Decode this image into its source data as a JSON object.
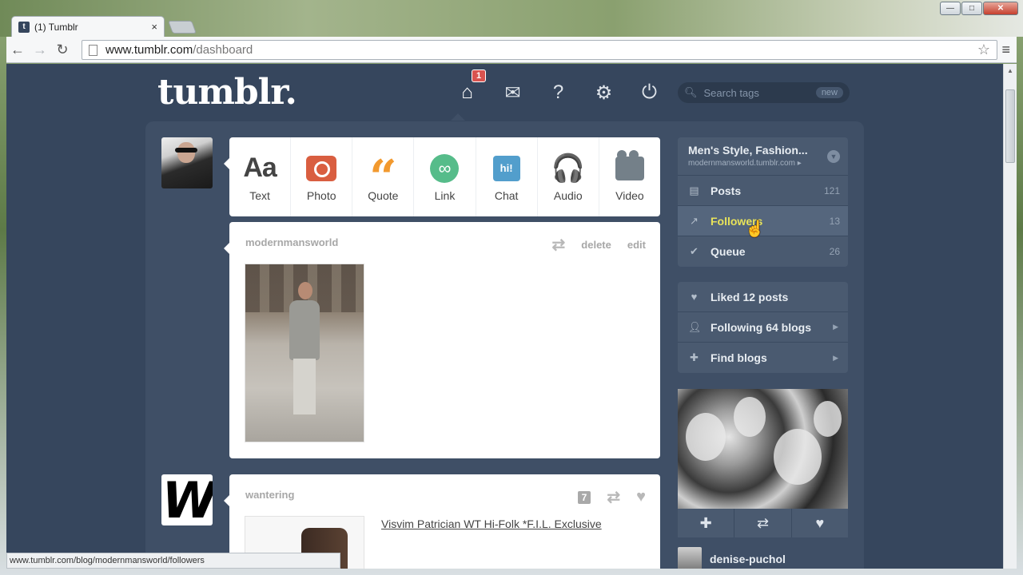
{
  "browser": {
    "tab_title": "(1) Tumblr",
    "tab_close": "×",
    "tab_favicon": "t",
    "url_host": "www.tumblr.com",
    "url_path": "/dashboard",
    "status_url": "www.tumblr.com/blog/modernmansworld/followers",
    "window_controls": {
      "minimize": "—",
      "maximize": "□",
      "close": "✕"
    }
  },
  "header": {
    "logo": "tumblr.",
    "notifications_count": "1",
    "search_placeholder": "Search tags",
    "search_badge": "new"
  },
  "post_types": [
    {
      "label": "Text",
      "glyph": "Aa",
      "color": "#444444"
    },
    {
      "label": "Photo",
      "glyph": "",
      "color": "#d95e40"
    },
    {
      "label": "Quote",
      "glyph": "“",
      "color": "#f2992e"
    },
    {
      "label": "Link",
      "glyph": "∞",
      "color": "#56bc8a"
    },
    {
      "label": "Chat",
      "glyph": "hi!",
      "color": "#529ecc"
    },
    {
      "label": "Audio",
      "glyph": "🎧",
      "color": "#a77dc2"
    },
    {
      "label": "Video",
      "glyph": "",
      "color": "#748089"
    }
  ],
  "posts": [
    {
      "author": "modernmansworld",
      "actions": {
        "delete": "delete",
        "edit": "edit"
      }
    },
    {
      "author": "wantering",
      "notes": "7",
      "link_title": "Visvim Patrician WT Hi-Folk *F.I.L. Exclusive"
    }
  ],
  "sidebar": {
    "blog_name": "Men's Style, Fashion...",
    "blog_url": "modernmansworld.tumblr.com ▸",
    "blog_rows": [
      {
        "label": "Posts",
        "count": "121",
        "icon": "document-icon"
      },
      {
        "label": "Followers",
        "count": "13",
        "icon": "chart-icon"
      },
      {
        "label": "Queue",
        "count": "26",
        "icon": "check-icon"
      }
    ],
    "stat_rows": [
      {
        "label": "Liked 12 posts",
        "icon": "heart-icon"
      },
      {
        "label": "Following 64 blogs",
        "icon": "person-icon"
      },
      {
        "label": "Find blogs",
        "icon": "add-person-icon"
      }
    ],
    "radar_user": "denise-puchol"
  },
  "colors": {
    "dashboard_bg": "#36465d",
    "panel_bg": "#3f4f66",
    "sidebar_bg": "#4a5a70",
    "hover_text": "#e8e35a",
    "badge": "#d9534f"
  }
}
